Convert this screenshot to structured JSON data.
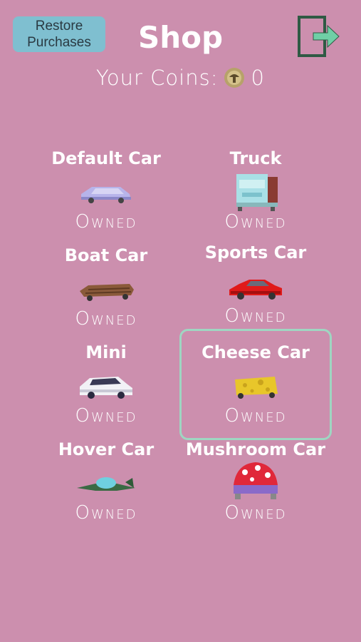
{
  "header": {
    "restore_line1": "Restore",
    "restore_line2": "Purchases",
    "title": "Shop",
    "coins_label": "Your Coins:",
    "coins_value": "0"
  },
  "items": [
    {
      "name": "Default Car",
      "status": "Owned"
    },
    {
      "name": "Truck",
      "status": "Owned"
    },
    {
      "name": "Boat Car",
      "status": "Owned"
    },
    {
      "name": "Sports Car",
      "status": "Owned"
    },
    {
      "name": "Mini",
      "status": "Owned"
    },
    {
      "name": "Cheese Car",
      "status": "Owned"
    },
    {
      "name": "Hover Car",
      "status": "Owned"
    },
    {
      "name": "Mushroom Car",
      "status": "Owned"
    }
  ],
  "selected_item": "Cheese Car",
  "colors": {
    "background": "#cc8fae",
    "restore_button": "#7fbfd0",
    "selection_border": "#9fd6c2",
    "exit_icon": "#2f5a44"
  }
}
